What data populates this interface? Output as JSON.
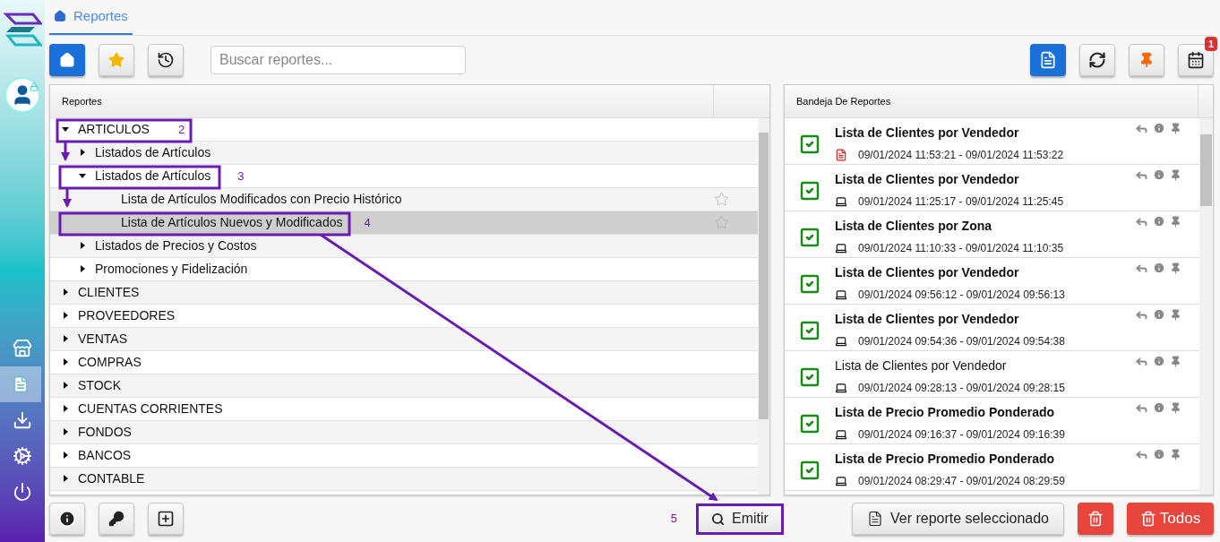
{
  "tab": {
    "label": "Reportes",
    "selected": true
  },
  "search": {
    "placeholder": "Buscar reportes..."
  },
  "calendar_badge": "1",
  "tree": {
    "header": "Reportes",
    "nodes": [
      {
        "kind": "folder",
        "label": "ARTICULOS",
        "expanded": true,
        "annotation": "2",
        "children": [
          {
            "kind": "folder",
            "label": "Listados de Artículos",
            "expanded": false
          },
          {
            "kind": "folder",
            "label": "Listados de Artículos",
            "expanded": true,
            "annotation": "3",
            "children": [
              {
                "kind": "report",
                "label": "Lista de Artículos Modificados con Precio Histórico",
                "selected": false,
                "favorite": false
              },
              {
                "kind": "report",
                "label": "Lista de Artículos Nuevos y Modificados",
                "selected": true,
                "favorite": false,
                "annotation": "4"
              }
            ]
          },
          {
            "kind": "folder",
            "label": "Listados de Precios y Costos",
            "expanded": false
          },
          {
            "kind": "folder",
            "label": "Promociones y Fidelización",
            "expanded": false
          }
        ]
      },
      {
        "kind": "folder",
        "label": "CLIENTES",
        "expanded": false
      },
      {
        "kind": "folder",
        "label": "PROVEEDORES",
        "expanded": false
      },
      {
        "kind": "folder",
        "label": "VENTAS",
        "expanded": false
      },
      {
        "kind": "folder",
        "label": "COMPRAS",
        "expanded": false
      },
      {
        "kind": "folder",
        "label": "STOCK",
        "expanded": false
      },
      {
        "kind": "folder",
        "label": "CUENTAS CORRIENTES",
        "expanded": false
      },
      {
        "kind": "folder",
        "label": "FONDOS",
        "expanded": false
      },
      {
        "kind": "folder",
        "label": "BANCOS",
        "expanded": false
      },
      {
        "kind": "folder",
        "label": "CONTABLE",
        "expanded": false
      }
    ]
  },
  "tray": {
    "header": "Bandeja De Reportes",
    "items": [
      {
        "title": "Lista de Clientes por Vendedor",
        "kind": "pdf",
        "read": false,
        "checked": true,
        "time": "09/01/2024 11:53:21 - 09/01/2024 11:53:22"
      },
      {
        "title": "Lista de Clientes por Vendedor",
        "kind": "screen",
        "read": false,
        "checked": true,
        "time": "09/01/2024 11:25:17 - 09/01/2024 11:25:45"
      },
      {
        "title": "Lista de Clientes por Zona",
        "kind": "screen",
        "read": false,
        "checked": true,
        "time": "09/01/2024 11:10:33 - 09/01/2024 11:10:35"
      },
      {
        "title": "Lista de Clientes por Vendedor",
        "kind": "screen",
        "read": false,
        "checked": true,
        "time": "09/01/2024 09:56:12 - 09/01/2024 09:56:13"
      },
      {
        "title": "Lista de Clientes por Vendedor",
        "kind": "screen",
        "read": false,
        "checked": true,
        "time": "09/01/2024 09:54:36 - 09/01/2024 09:54:38"
      },
      {
        "title": "Lista de Clientes por Vendedor",
        "kind": "screen",
        "read": true,
        "checked": true,
        "time": "09/01/2024 09:28:13 - 09/01/2024 09:28:15"
      },
      {
        "title": "Lista de Precio Promedio Ponderado",
        "kind": "screen",
        "read": false,
        "checked": true,
        "time": "09/01/2024 09:16:37 - 09/01/2024 09:16:39"
      },
      {
        "title": "Lista de Precio Promedio Ponderado",
        "kind": "screen",
        "read": false,
        "checked": true,
        "time": "09/01/2024 08:29:47 - 09/01/2024 08:29:59"
      }
    ]
  },
  "emit": {
    "label": "Emitir",
    "annotation": "5"
  },
  "view_button": "Ver reporte seleccionado",
  "delete_all_button": "Todos"
}
